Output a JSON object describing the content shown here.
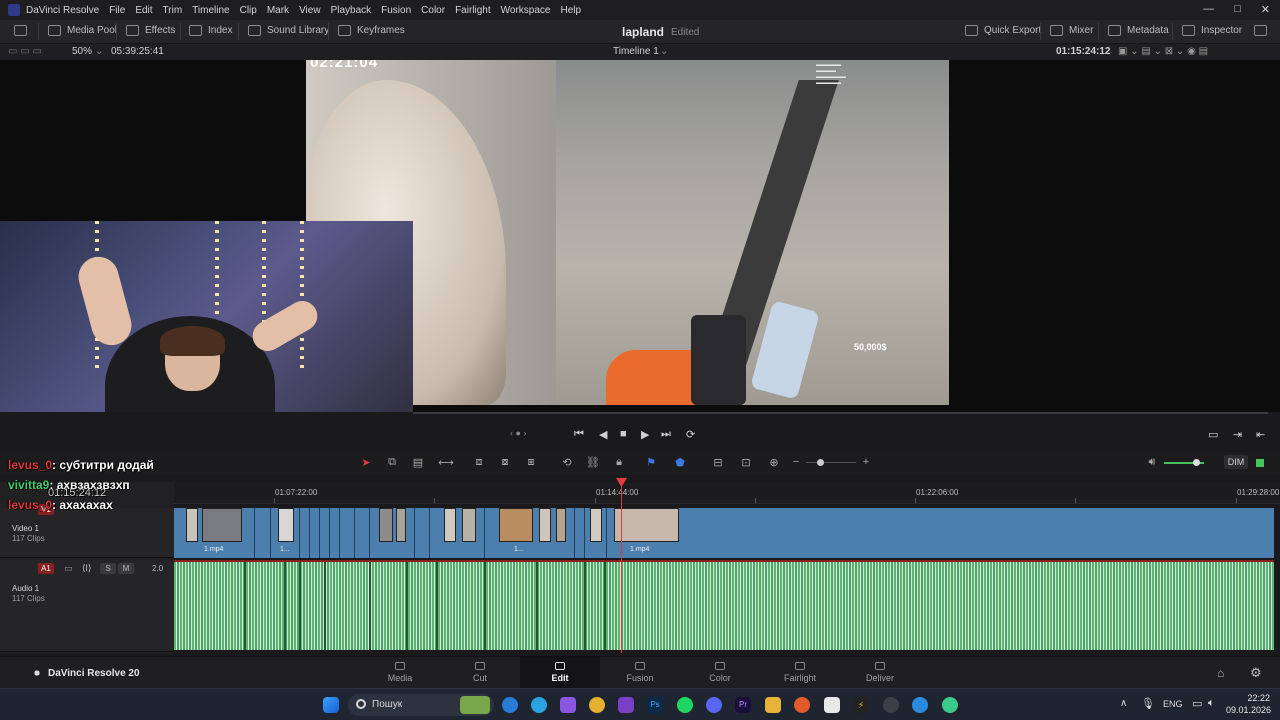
{
  "titlebar": {
    "app_name": "DaVinci Resolve",
    "menu": [
      "File",
      "Edit",
      "Trim",
      "Timeline",
      "Clip",
      "Mark",
      "View",
      "Playback",
      "Fusion",
      "Color",
      "Fairlight",
      "Workspace",
      "Help"
    ]
  },
  "toolbar": {
    "media_pool": "Media Pool",
    "effects": "Effects",
    "index": "Index",
    "sound_library": "Sound Library",
    "keyframes": "Keyframes",
    "project_name": "lapland",
    "project_status": "Edited",
    "quick_export": "Quick Export",
    "mixer": "Mixer",
    "metadata": "Metadata",
    "inspector": "Inspector"
  },
  "viewerbar": {
    "zoom": "50%",
    "source_timecode": "05:39:25:41",
    "timeline_name": "Timeline 1",
    "timeline_timecode": "01:15:24:12"
  },
  "video_overlay": {
    "stream_clock": "02:21:04",
    "donate_amount": "50,000$"
  },
  "chat_overlay": {
    "line1_user": "levus_0",
    "line1_msg": "субтитри додай",
    "line2_user": "vivitta9",
    "line2_msg": "ахвзахзвзхп",
    "line3_time": "01:15:24:12",
    "line3_user": "levus_0",
    "line3_msg": "ахахахах"
  },
  "timeline": {
    "dim_label": "DIM",
    "ruler": [
      "01:07:22:00",
      "01:14:44:00",
      "01:22:06:00",
      "01:29:28:00"
    ],
    "video_track": {
      "tag": "V1",
      "name": "Video 1",
      "clips": "117 Clips"
    },
    "audio_track": {
      "tag": "A1",
      "name": "Audio 1",
      "clips": "117 Clips",
      "level": "2.0"
    },
    "clip_labels": [
      "1.mp4",
      "1...",
      "1...",
      "1.mp4"
    ]
  },
  "pages": {
    "version_label": "DaVinci Resolve 20",
    "tabs": [
      "Media",
      "Cut",
      "Edit",
      "Fusion",
      "Color",
      "Fairlight",
      "Deliver"
    ],
    "active": "Edit"
  },
  "taskbar": {
    "search_placeholder": "Пошук",
    "lang": "ENG",
    "time": "22:22",
    "date": "09.01.2026"
  },
  "colors": {
    "accent_red": "#e23b3b",
    "video_track": "#4d7fae",
    "audio_track": "#52a66a"
  }
}
